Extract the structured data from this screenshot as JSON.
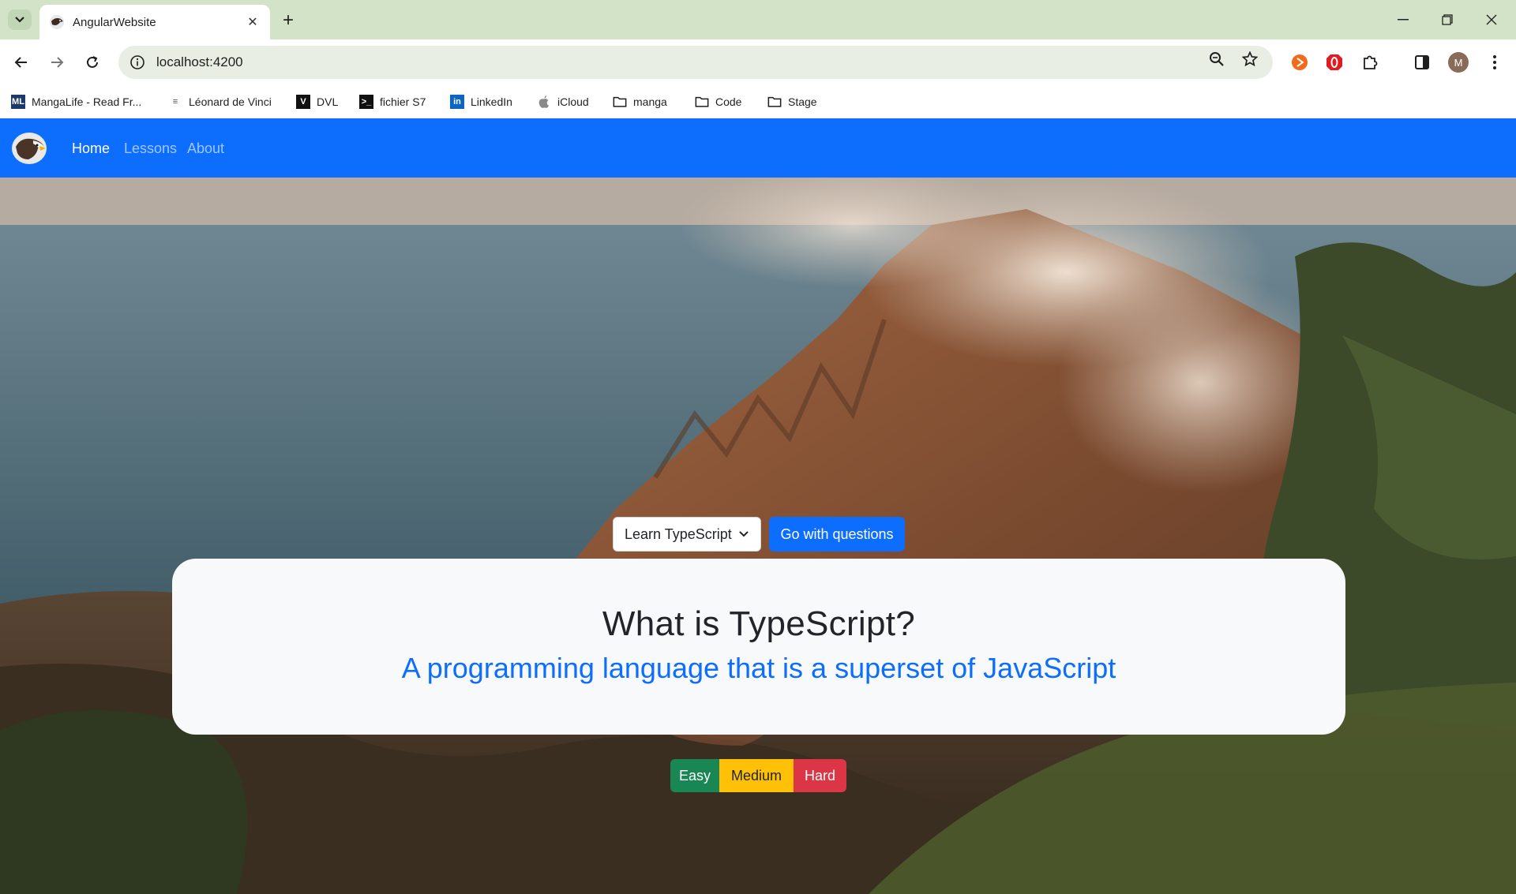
{
  "browser": {
    "tab": {
      "title": "AngularWebsite"
    },
    "url": "localhost:4200",
    "profile_initial": "M",
    "bookmarks": [
      {
        "label": "MangaLife - Read Fr...",
        "icon": "mangalife-icon"
      },
      {
        "label": "Léonard de Vinci",
        "icon": "devinci-icon"
      },
      {
        "label": "DVL",
        "icon": "dvl-icon"
      },
      {
        "label": "fichier S7",
        "icon": "terminal-icon"
      },
      {
        "label": "LinkedIn",
        "icon": "linkedin-icon"
      },
      {
        "label": "iCloud",
        "icon": "apple-icon"
      },
      {
        "label": "manga",
        "icon": "folder-icon"
      },
      {
        "label": "Code",
        "icon": "folder-icon"
      },
      {
        "label": "Stage",
        "icon": "folder-icon"
      }
    ]
  },
  "navbar": {
    "links": [
      {
        "label": "Home",
        "active": true
      },
      {
        "label": "Lessons",
        "active": false
      },
      {
        "label": "About",
        "active": false
      }
    ],
    "color": "#0d6efd"
  },
  "hero": {
    "select_value": "Learn TypeScript",
    "go_button": "Go with questions",
    "title": "What is TypeScript?",
    "subtitle": "A programming language that is a superset of JavaScript",
    "difficulty": [
      {
        "label": "Easy",
        "color": "#198754"
      },
      {
        "label": "Medium",
        "color": "#ffc107"
      },
      {
        "label": "Hard",
        "color": "#dc3545"
      }
    ]
  }
}
